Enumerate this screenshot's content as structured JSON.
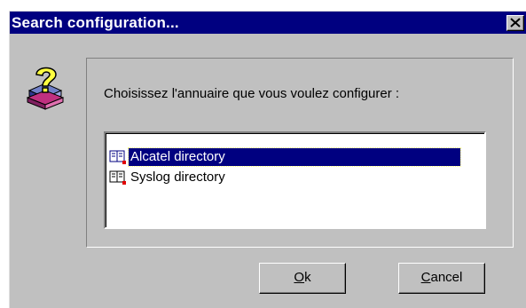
{
  "window": {
    "title": "Search configuration..."
  },
  "prompt": "Choisissez l'annuaire que vous voulez configurer :",
  "list": {
    "items": [
      {
        "label": "Alcatel directory",
        "selected": true,
        "icon": "directory-network-icon"
      },
      {
        "label": "Syslog directory",
        "selected": false,
        "icon": "directory-book-icon"
      }
    ]
  },
  "buttons": {
    "ok": {
      "mnemonic": "O",
      "rest": "k"
    },
    "cancel": {
      "mnemonic": "C",
      "rest": "ancel"
    }
  },
  "icons": {
    "app": "help-books-icon",
    "close": "close-icon"
  },
  "colors": {
    "titlebar": "#000080",
    "face": "#c0c0c0",
    "selection": "#000080"
  }
}
